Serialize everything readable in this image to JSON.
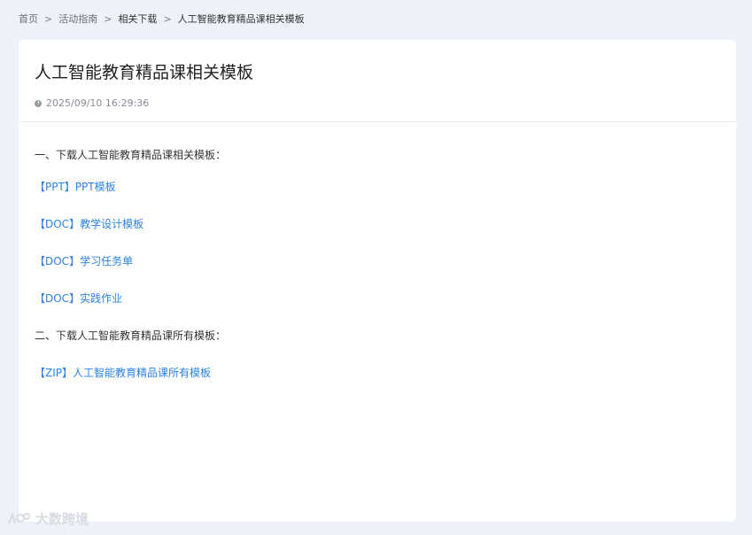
{
  "breadcrumb": {
    "items": [
      "首页",
      "活动指南",
      "相关下载",
      "人工智能教育精品课相关模板"
    ],
    "separator": ">"
  },
  "article": {
    "title": "人工智能教育精品课相关模板",
    "timestamp": "2025/09/10 16:29:36",
    "section1_heading": "一、下载人工智能教育精品课相关模板：",
    "links1": [
      "【PPT】PPT模板",
      "【DOC】教学设计模板",
      "【DOC】学习任务单",
      "【DOC】实践作业"
    ],
    "section2_heading": "二、下载人工智能教育精品课所有模板：",
    "links2": [
      "【ZIP】人工智能教育精品课所有模板"
    ]
  },
  "watermark": {
    "text": "大数跨境"
  },
  "colors": {
    "background": "#eef1f8",
    "card": "#ffffff",
    "link": "#2a82e4",
    "text": "#333333"
  },
  "icons": {
    "timestamp": "clock-icon",
    "watermark": "logo-icon"
  }
}
